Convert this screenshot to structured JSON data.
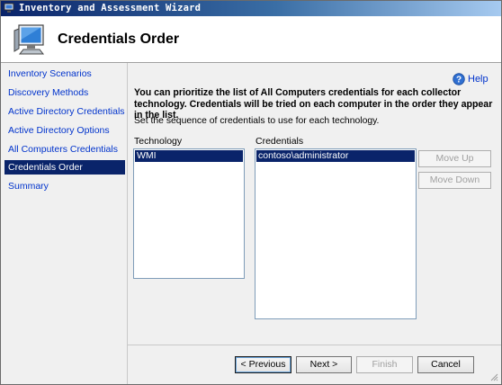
{
  "window": {
    "title": "Inventory and Assessment Wizard"
  },
  "header": {
    "title": "Credentials Order",
    "icon": "computer-monitor-icon"
  },
  "nav": {
    "items": [
      {
        "label": "Inventory Scenarios",
        "active": false
      },
      {
        "label": "Discovery Methods",
        "active": false
      },
      {
        "label": "Active Directory Credentials",
        "active": false
      },
      {
        "label": "Active Directory Options",
        "active": false
      },
      {
        "label": "All Computers Credentials",
        "active": false
      },
      {
        "label": "Credentials Order",
        "active": true
      },
      {
        "label": "Summary",
        "active": false
      }
    ]
  },
  "main": {
    "help_label": "Help",
    "intro": "You can prioritize the list of All Computers credentials for each collector technology. Credentials will be tried on each computer in the order they appear in the list.",
    "sequence_text": "Set the sequence of credentials to use for each technology.",
    "technology_label": "Technology",
    "technology_items": [
      "WMI"
    ],
    "credentials_label": "Credentials",
    "credentials_items": [
      "contoso\\administrator"
    ],
    "move_up_label": "Move Up",
    "move_down_label": "Move Down"
  },
  "footer": {
    "previous_label": "< Previous",
    "next_label": "Next >",
    "finish_label": "Finish",
    "cancel_label": "Cancel"
  },
  "colors": {
    "accent": "#0a246a",
    "link": "#0033cc",
    "panel": "#f0f0f0"
  }
}
